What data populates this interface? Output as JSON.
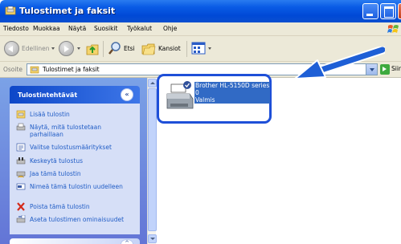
{
  "window": {
    "title": "Tulostimet ja faksit"
  },
  "menu": {
    "items": [
      "Tiedosto",
      "Muokkaa",
      "Näytä",
      "Suosikit",
      "Työkalut",
      "Ohje"
    ]
  },
  "toolbar": {
    "back_label": "Edellinen",
    "search_label": "Etsi",
    "folders_label": "Kansiot"
  },
  "address": {
    "label": "Osoite",
    "value": "Tulostimet ja faksit",
    "go_label": "Siirry"
  },
  "taskpane": {
    "header": "Tulostintehtävät",
    "collapse_symbol": "«",
    "tasks": [
      {
        "label": "Lisää tulostin",
        "icon": "add-printer-icon"
      },
      {
        "label": "Näytä, mitä tulostetaan parhaillaan",
        "icon": "print-queue-icon"
      },
      {
        "label": "Valitse tulostusmääritykset",
        "icon": "print-prefs-icon"
      },
      {
        "label": "Keskeytä tulostus",
        "icon": "pause-print-icon"
      },
      {
        "label": "Jaa tämä tulostin",
        "icon": "share-printer-icon"
      },
      {
        "label": "Nimeä tämä tulostin uudelleen",
        "icon": "rename-printer-icon"
      },
      {
        "label": "Poista tämä tulostin",
        "icon": "delete-x-icon"
      },
      {
        "label": "Aseta tulostimen ominaisuudet",
        "icon": "printer-properties-icon"
      }
    ],
    "second_box_symbol": "^"
  },
  "printer": {
    "name": "Brother HL-5150D series",
    "documents": "0",
    "status": "Valmis",
    "is_default": true
  },
  "colors": {
    "accent": "#316ac5",
    "highlight_box": "#1e4fd8",
    "arrow": "#1e5fd6",
    "task_link": "#215dc6"
  }
}
